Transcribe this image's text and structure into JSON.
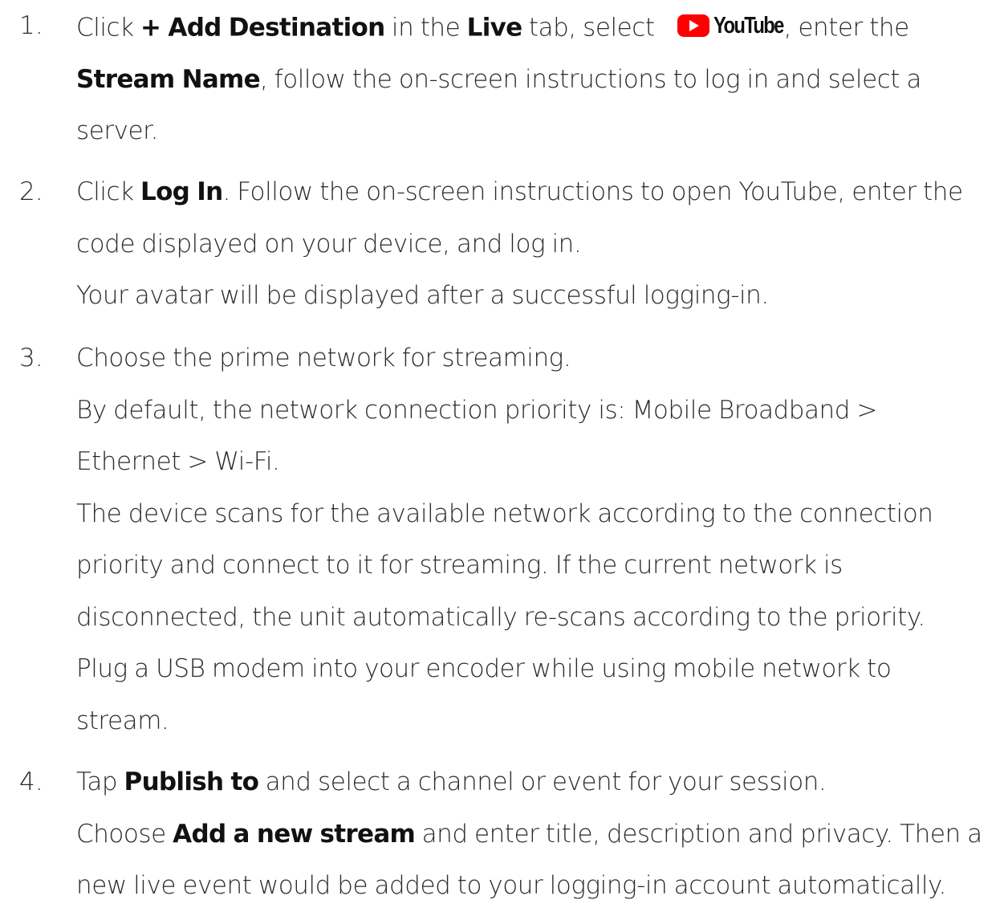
{
  "steps": [
    {
      "number": "1.",
      "segments": {
        "a": "Click ",
        "b": "+ Add Destination",
        "c": " in the ",
        "d": "Live",
        "e": " tab, select",
        "logo_text": "YouTube",
        "f": ", enter the",
        "g": "Stream Name",
        "h": ", follow the on-screen instructions to log in and select a",
        "i": "server."
      }
    },
    {
      "number": "2.",
      "segments": {
        "a": "Click ",
        "b": "Log In",
        "c": ". Follow the on-screen instructions to open YouTube, enter the",
        "d": "code displayed on your device, and log in.",
        "e": "Your avatar will be displayed after a successful logging-in."
      }
    },
    {
      "number": "3.",
      "lines": [
        "Choose the prime network for streaming.",
        "By default, the network connection priority is: Mobile Broadband >",
        "Ethernet > Wi-Fi.",
        "The device scans for the available network according to the connection",
        "priority and connect to it for streaming. If the current network is",
        "disconnected, the unit automatically re-scans according to the priority.",
        "Plug a USB modem into your encoder while using mobile network to",
        "stream."
      ]
    },
    {
      "number": "4.",
      "segments": {
        "a": "Tap ",
        "b": "Publish to",
        "c": " and select a channel or event for your session.",
        "d": "Choose ",
        "e": "Add a new stream",
        "f": " and enter title, description and privacy. Then a",
        "g": "new live event would be added to your logging-in account automatically."
      }
    }
  ],
  "colors": {
    "text": "#2a2a2a",
    "bold_text": "#111111",
    "youtube_red": "#ff0000"
  },
  "icons": {
    "youtube_logo": "youtube-logo-icon"
  }
}
